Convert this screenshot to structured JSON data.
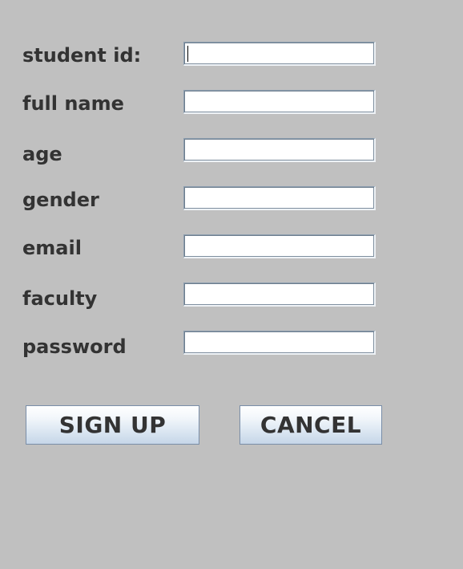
{
  "form": {
    "fields": [
      {
        "label": "student id:",
        "value": ""
      },
      {
        "label": "full name",
        "value": ""
      },
      {
        "label": "age",
        "value": ""
      },
      {
        "label": "gender",
        "value": ""
      },
      {
        "label": "email",
        "value": ""
      },
      {
        "label": "faculty",
        "value": ""
      },
      {
        "label": "password",
        "value": ""
      }
    ]
  },
  "buttons": {
    "signup_label": "SIGN UP",
    "cancel_label": "CANCEL"
  },
  "colors": {
    "background": "#c0c0c0",
    "label_text": "#333333",
    "field_border": "#8e9fb0",
    "button_gradient_bottom": "#c6d6e8"
  }
}
